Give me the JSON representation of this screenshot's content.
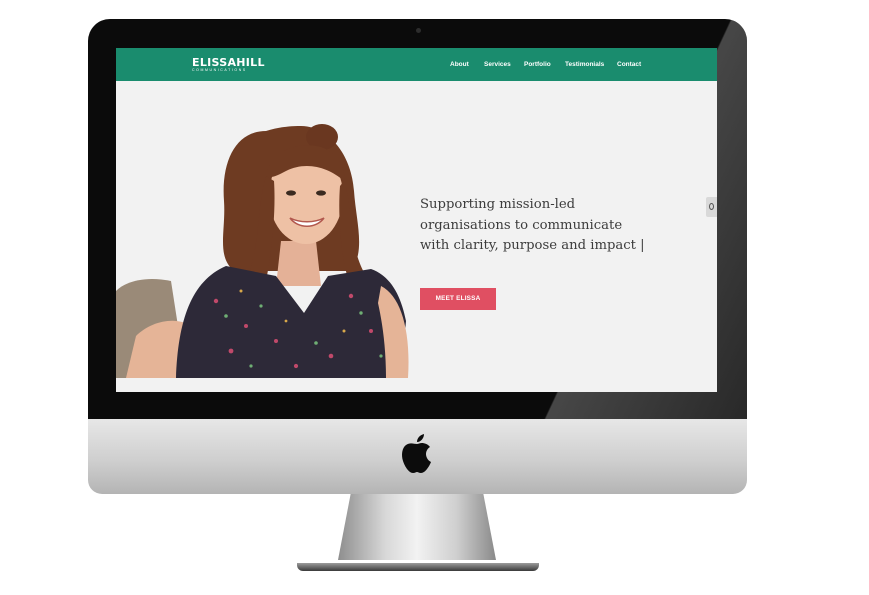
{
  "site": {
    "logo_main": "ELISSAHILL",
    "logo_sub": "COMMUNICATIONS"
  },
  "nav": {
    "items": [
      {
        "label": "About"
      },
      {
        "label": "Services"
      },
      {
        "label": "Portfolio"
      },
      {
        "label": "Testimonials"
      },
      {
        "label": "Contact"
      }
    ]
  },
  "hero": {
    "tagline_lines": [
      "Supporting mission-led",
      "organisations to communicate",
      "with clarity, purpose and impact |"
    ],
    "cta_label": "MEET ELISSA"
  },
  "colors": {
    "brand_green": "#1a8c6e",
    "cta_red": "#e04f62",
    "page_background": "#f2f2f2"
  },
  "icons": {
    "device": "apple-logo-icon",
    "side_tab": "chat-icon"
  }
}
